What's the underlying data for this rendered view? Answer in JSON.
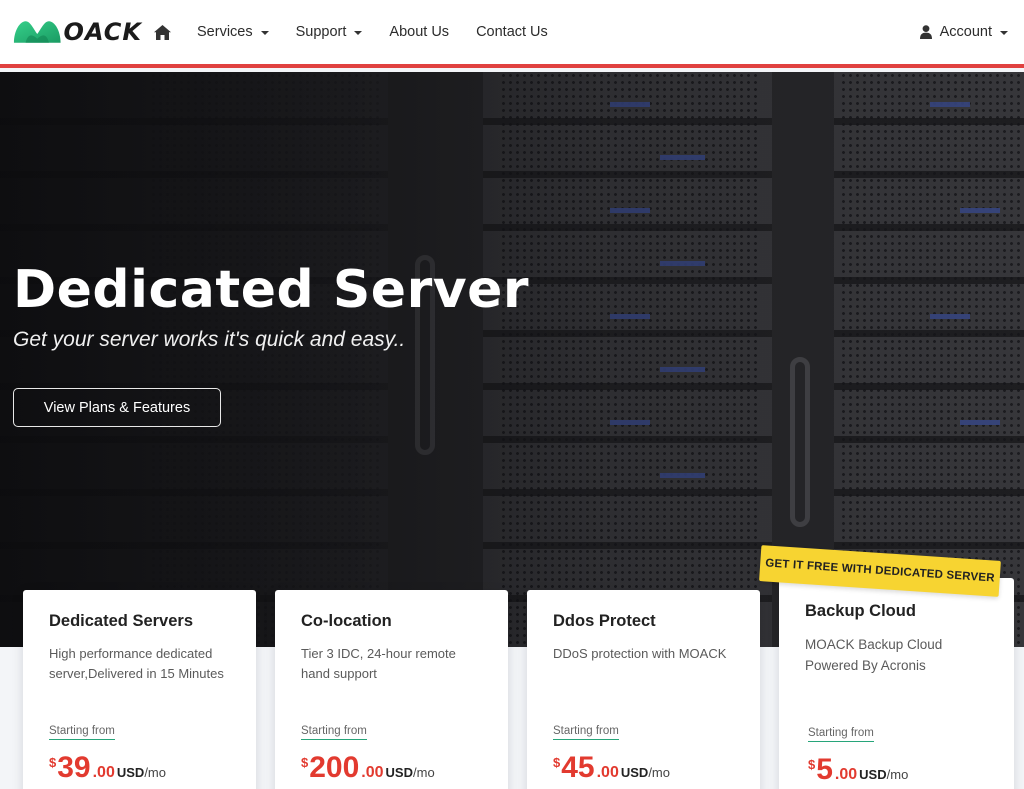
{
  "brand": {
    "logo_text": "OACK"
  },
  "nav": {
    "items": [
      {
        "label": "Services",
        "dropdown": true
      },
      {
        "label": "Support",
        "dropdown": true
      },
      {
        "label": "About Us",
        "dropdown": false
      },
      {
        "label": "Contact Us",
        "dropdown": false
      }
    ],
    "account_label": "Account"
  },
  "hero": {
    "title": "Dedicated Server",
    "subtitle": "Get your server works it's quick and easy..",
    "button_label": "View Plans & Features"
  },
  "ribbon": "GET IT FREE WITH DEDICATED SERVER",
  "cards": [
    {
      "title": "Dedicated Servers",
      "desc": "High performance dedicated server,Delivered in 15 Minutes",
      "starting": "Starting from",
      "currency": "$",
      "amount": "39",
      "decimal": ".00",
      "unit": "USD",
      "per": "/mo"
    },
    {
      "title": "Co-location",
      "desc": "Tier 3 IDC, 24-hour remote hand support",
      "starting": "Starting from",
      "currency": "$",
      "amount": "200",
      "decimal": ".00",
      "unit": "USD",
      "per": "/mo"
    },
    {
      "title": "Ddos Protect",
      "desc": "DDoS protection with MOACK",
      "starting": "Starting from",
      "currency": "$",
      "amount": "45",
      "decimal": ".00",
      "unit": "USD",
      "per": "/mo"
    },
    {
      "title": "Backup Cloud",
      "desc": "MOACK Backup Cloud Powered By Acronis",
      "starting": "Starting from",
      "currency": "$",
      "amount": "5",
      "decimal": ".00",
      "unit": "USD",
      "per": "/mo"
    }
  ],
  "colors": {
    "accent_red": "#e0413f",
    "price_red": "#e23a2f",
    "ribbon_yellow": "#f7d431",
    "logo_green": "#2bbf7a"
  }
}
